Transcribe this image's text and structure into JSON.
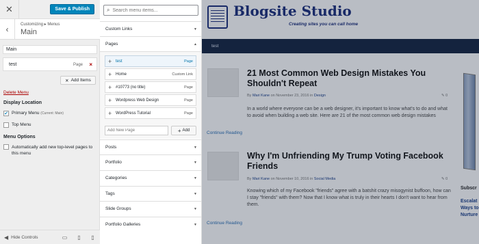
{
  "customizer": {
    "save_label": "Save & Publish",
    "breadcrumb": "Customizing ▸ Menus",
    "panel_title": "Main",
    "menu_name_value": "Main",
    "menu_items": [
      {
        "label": "test",
        "type": "Page"
      }
    ],
    "add_items_label": "Add Items",
    "delete_menu_label": "Delete Menu",
    "display_location_heading": "Display Location",
    "locations": [
      {
        "label": "Primary Menu",
        "sub": "(Current: Main)",
        "checked": true
      },
      {
        "label": "Top Menu",
        "sub": "",
        "checked": false
      }
    ],
    "menu_options_heading": "Menu Options",
    "auto_add_label": "Automatically add new top-level pages to this menu",
    "auto_add_checked": false,
    "hide_controls_label": "Hide Controls"
  },
  "available_items": {
    "search_placeholder": "Search menu items...",
    "sections_before": [
      "Custom Links"
    ],
    "pages_section": {
      "title": "Pages",
      "items": [
        {
          "label": "test",
          "type": "Page",
          "selected": true
        },
        {
          "label": "Home",
          "type": "Custom Link",
          "selected": false
        },
        {
          "label": "#10773 (no title)",
          "type": "Page",
          "selected": false
        },
        {
          "label": "Wordpress Web Design",
          "type": "Page",
          "selected": false
        },
        {
          "label": "WordPress Tutorial",
          "type": "Page",
          "selected": false
        }
      ],
      "add_new_placeholder": "Add New Page",
      "add_button_label": "Add"
    },
    "sections_after": [
      "Posts",
      "Portfolio",
      "Categories",
      "Tags",
      "Slide Groups",
      "Portfolio Galleries"
    ]
  },
  "preview": {
    "site_title": "Blogsite Studio",
    "tagline": "Creating sites you can call home",
    "nav_item": "test",
    "posts": [
      {
        "title": "21 Most Common Web Design Mistakes You Shouldn't Repeat",
        "meta_by": "By",
        "author": "Mari Kane",
        "meta_on": "on November 23, 2016 in",
        "category": "Design",
        "comments": "0",
        "excerpt": "In a world where everyone can be a web designer, it's important to know what's to do and what to avoid when building a web site. Here are 21 of the most common web design mistakes",
        "continue": "Continue Reading"
      },
      {
        "title": "Why I'm Unfriending My Trump Voting Facebook Friends",
        "meta_by": "By",
        "author": "Mari Kane",
        "meta_on": "on November 10, 2016 in",
        "category": "Social Media",
        "comments": "0",
        "excerpt": "Knowing which of my Facebook \"friends\" agree with a batshit crazy misogynist buffoon, how can I stay \"friends\" with them? Now that I know what is truly in their hearts I don't want to hear from them.",
        "continue": "Continue Reading"
      }
    ],
    "sidebar_label": "Subscr",
    "sidebar_link": "Escalat Ways to Nurture"
  }
}
